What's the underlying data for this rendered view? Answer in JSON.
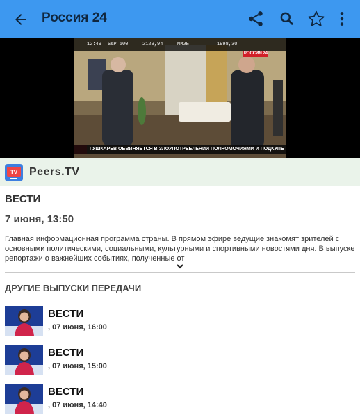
{
  "app_bar": {
    "title": "Россия 24",
    "icons": [
      "back-arrow-icon",
      "share-icon",
      "search-icon",
      "star-icon",
      "more-vert-icon"
    ],
    "color": "#3d98f0"
  },
  "video": {
    "ticker": {
      "time": "12:49",
      "item1": "S&P 500",
      "item2": "2129,94",
      "item3": "МИЭБ",
      "item4": "1998,30"
    },
    "channel_logo": "РОССИЯ 24",
    "caption": "ГУШКАРЕВ ОБВИНЯЕТСЯ В ЗЛОУПОТРЕБЛЕНИИ ПОЛНОМОЧИЯМИ И ПОДКУПЕ"
  },
  "provider": {
    "name": "Peers.TV",
    "logo_text": "TV"
  },
  "program": {
    "title": "ВЕСТИ",
    "date": "7 июня, 13:50",
    "description": "Главная информационная программа страны. В прямом эфире ведущие знакомят зрителей с основными политическими, социальными, культурными и спортивными новостями дня. В выпуске репортажи о важнейших событиях, полученные от"
  },
  "other_episodes": {
    "heading": "ДРУГИЕ ВЫПУСКИ ПЕРЕДАЧИ",
    "items": [
      {
        "title": "ВЕСТИ",
        "time": ", 07 июня, 16:00"
      },
      {
        "title": "ВЕСТИ",
        "time": ", 07 июня, 15:00"
      },
      {
        "title": "ВЕСТИ",
        "time": ", 07 июня, 14:40"
      }
    ]
  }
}
